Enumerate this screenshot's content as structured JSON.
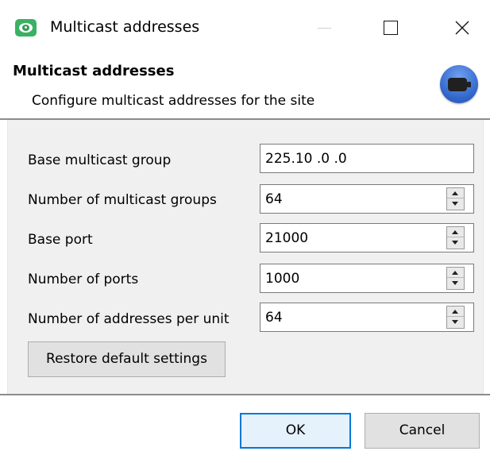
{
  "window": {
    "title": "Multicast addresses",
    "app_icon": "eye-app-icon",
    "controls": [
      "minimize-icon",
      "maximize-icon",
      "close-icon"
    ]
  },
  "header": {
    "title": "Multicast addresses",
    "subtitle": "Configure multicast addresses for the site",
    "icon": "camera-icon"
  },
  "form": {
    "fields": [
      {
        "label": "Base multicast group",
        "value": "225.10 .0  .0",
        "type": "ip"
      },
      {
        "label": "Number of multicast groups",
        "value": "64",
        "type": "spinner"
      },
      {
        "label": "Base port",
        "value": "21000",
        "type": "spinner"
      },
      {
        "label": "Number of ports",
        "value": "1000",
        "type": "spinner"
      },
      {
        "label": "Number of addresses per unit",
        "value": "64",
        "type": "spinner"
      }
    ],
    "restore_label": "Restore default settings"
  },
  "footer": {
    "ok_label": "OK",
    "cancel_label": "Cancel"
  },
  "colors": {
    "accent": "#0078d7",
    "app_icon": "#3bb163",
    "header_icon": "#3a72d8",
    "panel_bg": "#f0f0f0"
  }
}
